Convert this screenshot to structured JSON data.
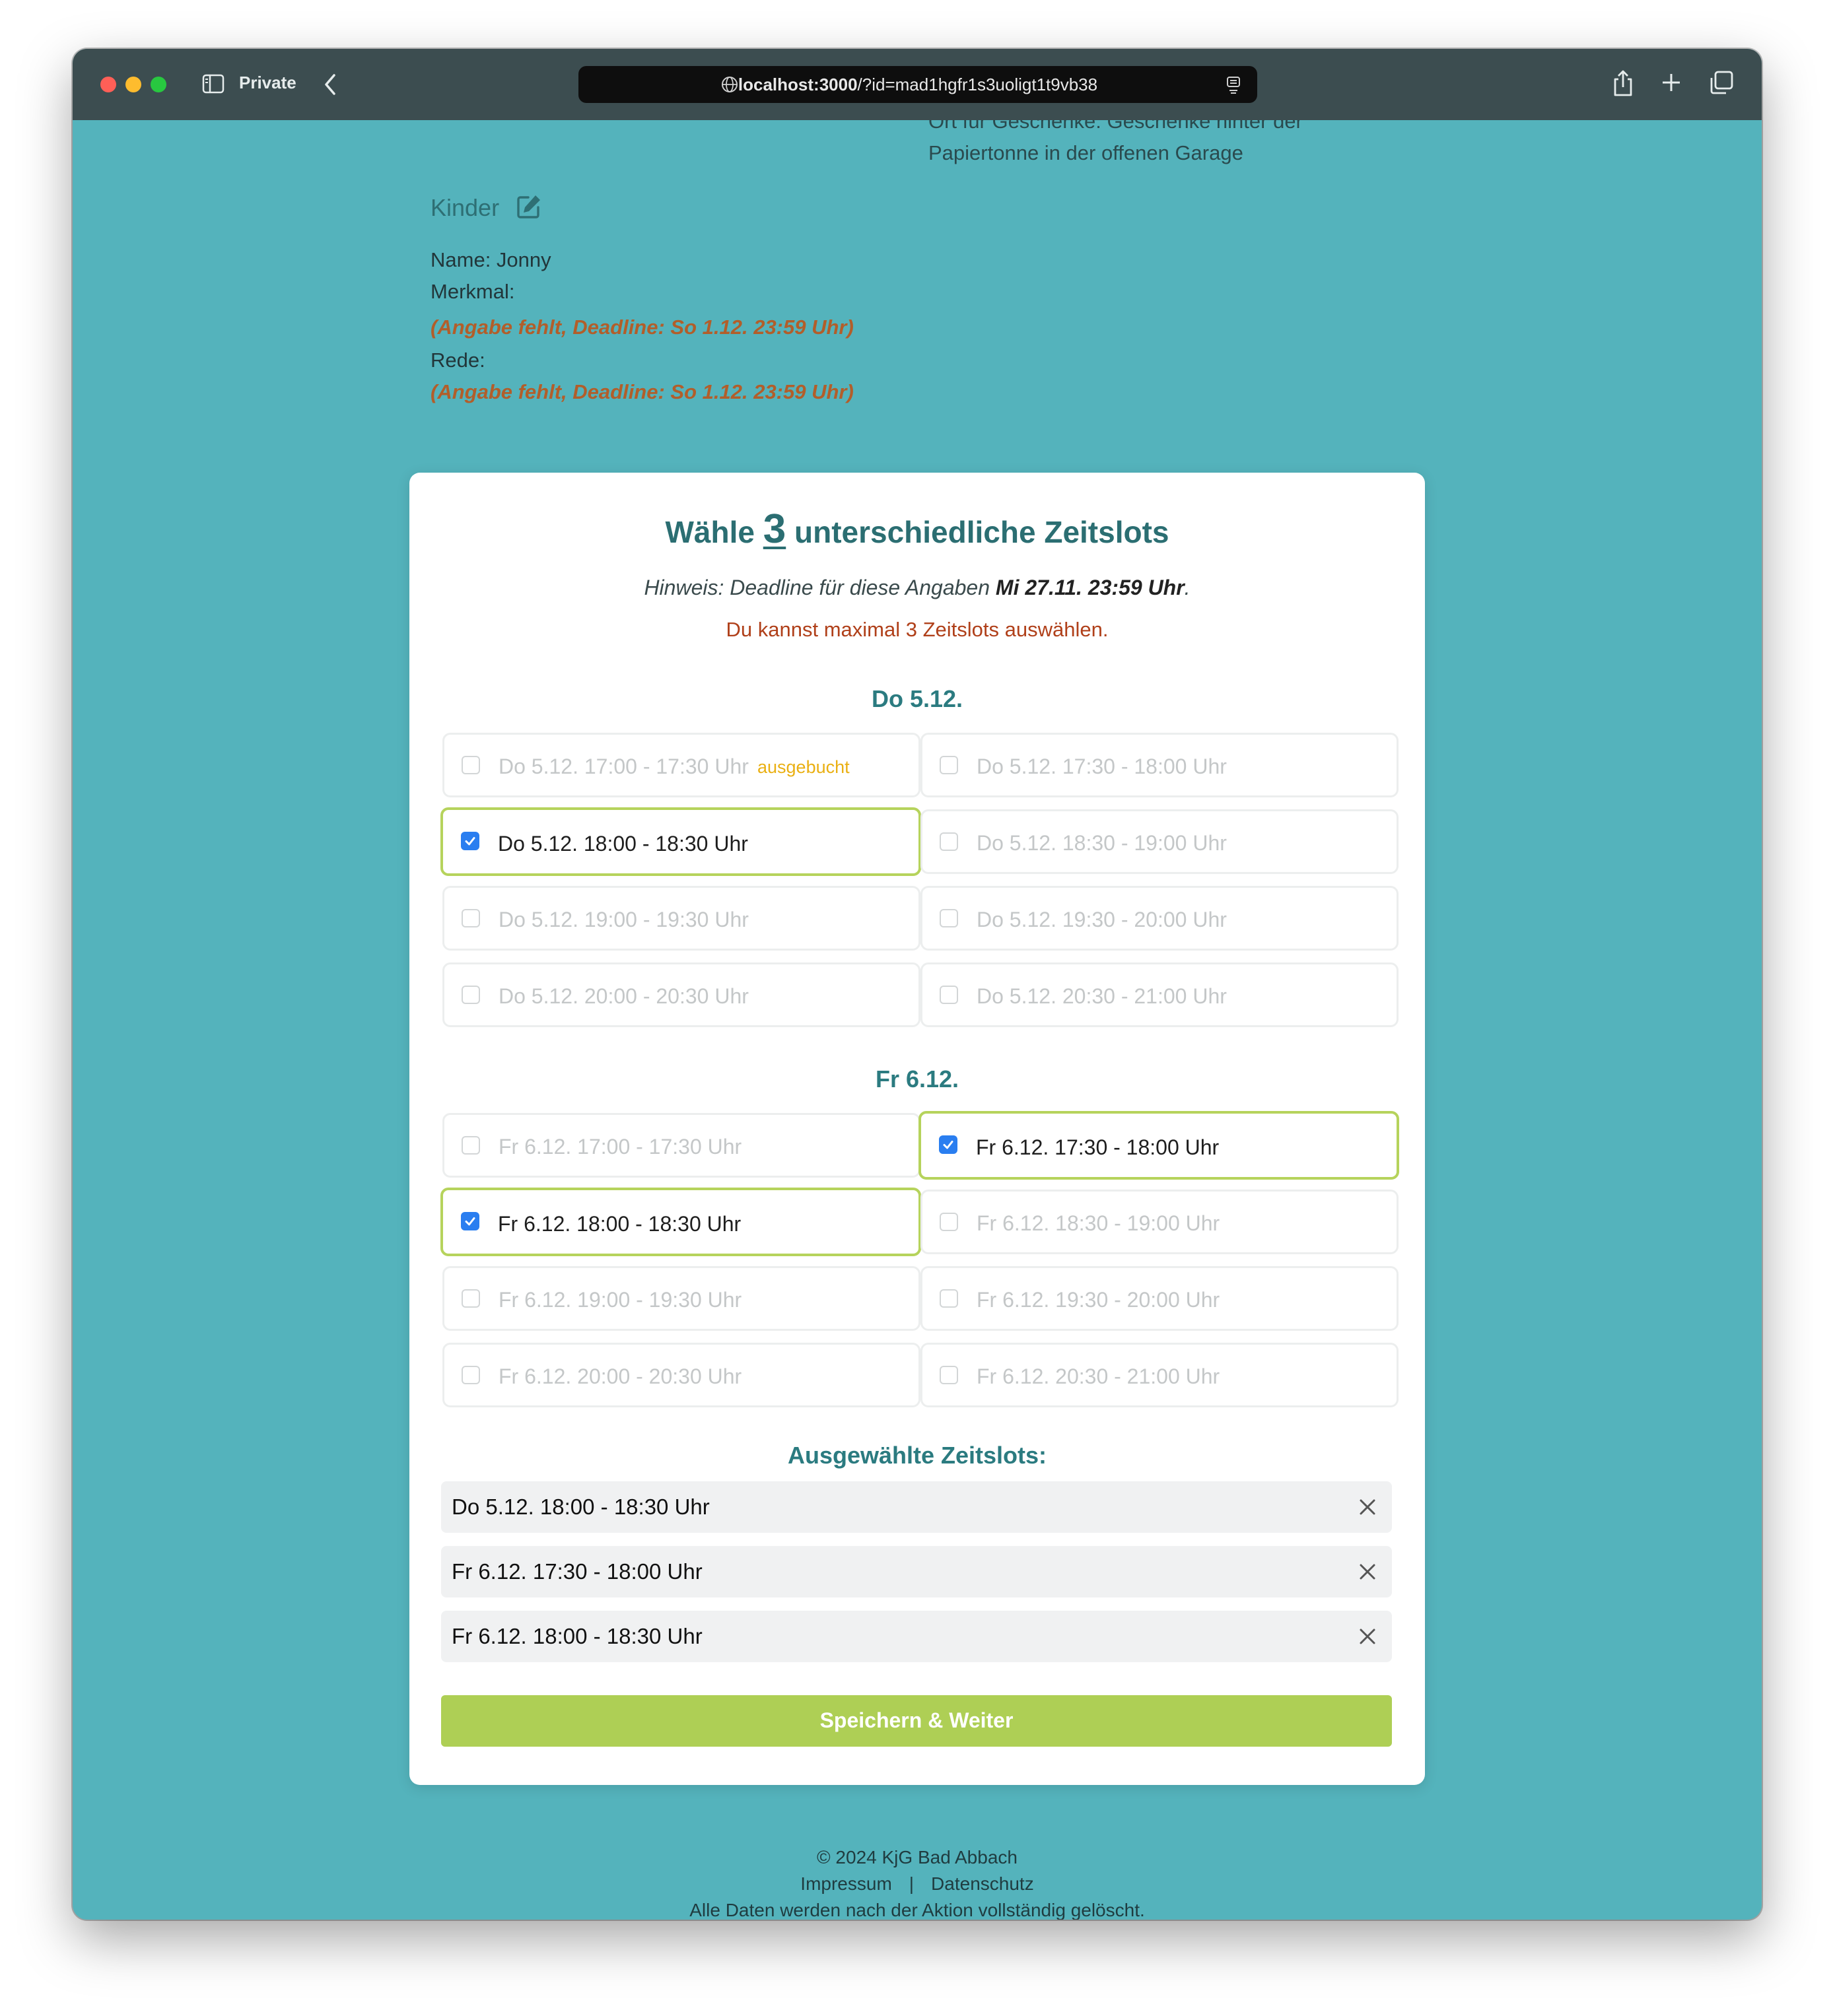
{
  "browser": {
    "private_label": "Private",
    "url_host": "localhost:3000",
    "url_path": "/?id=mad1hgfr1s3uoligt1t9vb38"
  },
  "top": {
    "cut_line1": "Ort für Geschenke: Geschenke hinter der",
    "cut_line2": "Papiertonne in der offenen Garage"
  },
  "kinder": {
    "title": "Kinder",
    "name": "Name: Jonny",
    "merkmal_label": "Merkmal:",
    "merkmal_missing": "(Angabe fehlt, Deadline: So 1.12. 23:59 Uhr)",
    "rede_label": "Rede:",
    "rede_missing": "(Angabe fehlt, Deadline: So 1.12. 23:59 Uhr)"
  },
  "card": {
    "title_pre": "Wähle",
    "title_num": "3",
    "title_post": "unterschiedliche Zeitslots",
    "hint_text": "Hinweis: Deadline für diese Angaben",
    "hint_deadline": "Mi 27.11. 23:59 Uhr",
    "hint_end": ".",
    "warning": "Du kannst maximal 3 Zeitslots auswählen.",
    "booked_label": "ausgebucht"
  },
  "days": [
    {
      "heading": "Do 5.12.",
      "slots": [
        {
          "label": "Do 5.12. 17:00 - 17:30 Uhr",
          "checked": false,
          "booked": true
        },
        {
          "label": "Do 5.12. 17:30 - 18:00 Uhr",
          "checked": false,
          "booked": false
        },
        {
          "label": "Do 5.12. 18:00 - 18:30 Uhr",
          "checked": true,
          "booked": false
        },
        {
          "label": "Do 5.12. 18:30 - 19:00 Uhr",
          "checked": false,
          "booked": false
        },
        {
          "label": "Do 5.12. 19:00 - 19:30 Uhr",
          "checked": false,
          "booked": false
        },
        {
          "label": "Do 5.12. 19:30 - 20:00 Uhr",
          "checked": false,
          "booked": false
        },
        {
          "label": "Do 5.12. 20:00 - 20:30 Uhr",
          "checked": false,
          "booked": false
        },
        {
          "label": "Do 5.12. 20:30 - 21:00 Uhr",
          "checked": false,
          "booked": false
        }
      ]
    },
    {
      "heading": "Fr 6.12.",
      "slots": [
        {
          "label": "Fr 6.12. 17:00 - 17:30 Uhr",
          "checked": false,
          "booked": false
        },
        {
          "label": "Fr 6.12. 17:30 - 18:00 Uhr",
          "checked": true,
          "booked": false
        },
        {
          "label": "Fr 6.12. 18:00 - 18:30 Uhr",
          "checked": true,
          "booked": false
        },
        {
          "label": "Fr 6.12. 18:30 - 19:00 Uhr",
          "checked": false,
          "booked": false
        },
        {
          "label": "Fr 6.12. 19:00 - 19:30 Uhr",
          "checked": false,
          "booked": false
        },
        {
          "label": "Fr 6.12. 19:30 - 20:00 Uhr",
          "checked": false,
          "booked": false
        },
        {
          "label": "Fr 6.12. 20:00 - 20:30 Uhr",
          "checked": false,
          "booked": false
        },
        {
          "label": "Fr 6.12. 20:30 - 21:00 Uhr",
          "checked": false,
          "booked": false
        }
      ]
    }
  ],
  "selected": {
    "heading": "Ausgewählte Zeitslots:",
    "items": [
      "Do 5.12. 18:00 - 18:30 Uhr",
      "Fr 6.12. 17:30 - 18:00 Uhr",
      "Fr 6.12. 18:00 - 18:30 Uhr"
    ]
  },
  "save_label": "Speichern & Weiter",
  "footer": {
    "copyright": "© 2024 KjG Bad Abbach",
    "impressum": "Impressum",
    "separator": "|",
    "datenschutz": "Datenschutz",
    "note": "Alle Daten werden nach der Aktion vollständig gelöscht."
  },
  "colors": {
    "page_bg": "#54b3bc",
    "accent": "#2b6e72",
    "selected_border": "#b6d35c",
    "button": "#aecf55",
    "warning": "#b0401a",
    "booked": "#eab013"
  }
}
